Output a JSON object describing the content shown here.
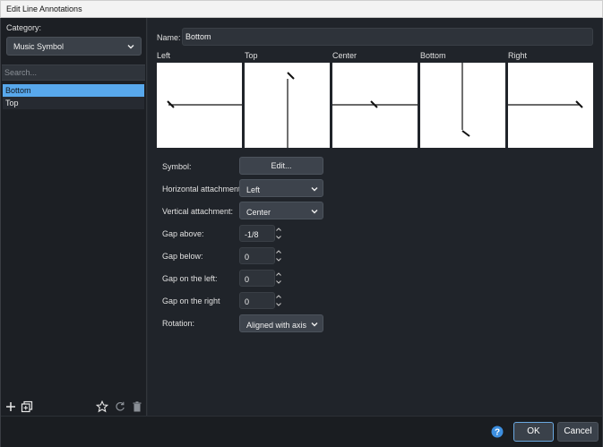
{
  "window": {
    "title": "Edit Line Annotations"
  },
  "sidebar": {
    "category_label": "Category:",
    "category_value": "Music Symbol",
    "search_placeholder": "Search...",
    "items": [
      {
        "label": "Bottom",
        "selected": true
      },
      {
        "label": "Top",
        "selected": false
      }
    ],
    "footer_icons": [
      "add-icon",
      "duplicate-icon",
      "star-icon",
      "reset-icon",
      "trash-icon"
    ]
  },
  "main": {
    "name_label": "Name:",
    "name_value": "Bottom",
    "previews": [
      {
        "label": "Left"
      },
      {
        "label": "Top"
      },
      {
        "label": "Center"
      },
      {
        "label": "Bottom"
      },
      {
        "label": "Right"
      }
    ],
    "form": {
      "symbol_label": "Symbol:",
      "symbol_button": "Edit...",
      "horizontal_label": "Horizontal attachment:",
      "horizontal_value": "Left",
      "vertical_label": "Vertical attachment:",
      "vertical_value": "Center",
      "gap_above_label": "Gap above:",
      "gap_above_value": "-1/8",
      "gap_below_label": "Gap below:",
      "gap_below_value": "0",
      "gap_left_label": "Gap on the left:",
      "gap_left_value": "0",
      "gap_right_label": "Gap on the right",
      "gap_right_value": "0",
      "rotation_label": "Rotation:",
      "rotation_value": "Aligned with axis"
    }
  },
  "footer": {
    "help_icon": "help-icon",
    "ok_label": "OK",
    "cancel_label": "Cancel"
  },
  "colors": {
    "accent": "#58a8ec",
    "help": "#3d8fe0"
  }
}
